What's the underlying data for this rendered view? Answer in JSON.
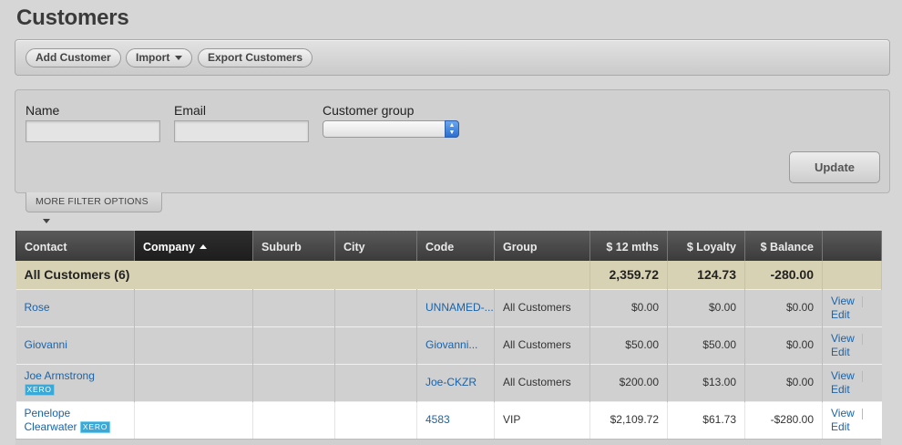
{
  "page": {
    "title": "Customers"
  },
  "toolbar": {
    "add_label": "Add Customer",
    "import_label": "Import",
    "export_label": "Export Customers"
  },
  "filters": {
    "name_label": "Name",
    "name_value": "",
    "email_label": "Email",
    "email_value": "",
    "group_label": "Customer group",
    "group_value": "",
    "update_label": "Update",
    "more_label": "MORE FILTER OPTIONS"
  },
  "table": {
    "columns": [
      "Contact",
      "Company",
      "Suburb",
      "City",
      "Code",
      "Group",
      "$ 12 mths",
      "$ Loyalty",
      "$ Balance",
      ""
    ],
    "sorted_column": "Company",
    "summary": {
      "label": "All Customers (6)",
      "twelve_mths": "2,359.72",
      "loyalty": "124.73",
      "balance": "-280.00"
    },
    "rows": [
      {
        "contact": "Rose",
        "xero": "",
        "company": "",
        "suburb": "",
        "city": "",
        "code": "UNNAMED-...",
        "group": "All Customers",
        "twelve_mths": "$0.00",
        "loyalty": "$0.00",
        "balance": "$0.00",
        "view": "View",
        "edit": "Edit"
      },
      {
        "contact": "Giovanni",
        "xero": "",
        "company": "",
        "suburb": "",
        "city": "",
        "code": "Giovanni...",
        "group": "All Customers",
        "twelve_mths": "$50.00",
        "loyalty": "$50.00",
        "balance": "$0.00",
        "view": "View",
        "edit": "Edit"
      },
      {
        "contact": "Joe Armstrong",
        "xero": "XERO",
        "company": "",
        "suburb": "",
        "city": "",
        "code": "Joe-CKZR",
        "group": "All Customers",
        "twelve_mths": "$200.00",
        "loyalty": "$13.00",
        "balance": "$0.00",
        "view": "View",
        "edit": "Edit"
      },
      {
        "contact": "Penelope Clearwater",
        "xero": "XERO",
        "company": "",
        "suburb": "",
        "city": "",
        "code": "4583",
        "group": "VIP",
        "twelve_mths": "$2,109.72",
        "loyalty": "$61.73",
        "balance": "-$280.00",
        "view": "View",
        "edit": "Edit"
      }
    ]
  },
  "colors": {
    "link": "#1a63a8",
    "header_bg": "#444444",
    "summary_bg": "#d8d2b4",
    "xero_badge": "#3aa9d8"
  }
}
